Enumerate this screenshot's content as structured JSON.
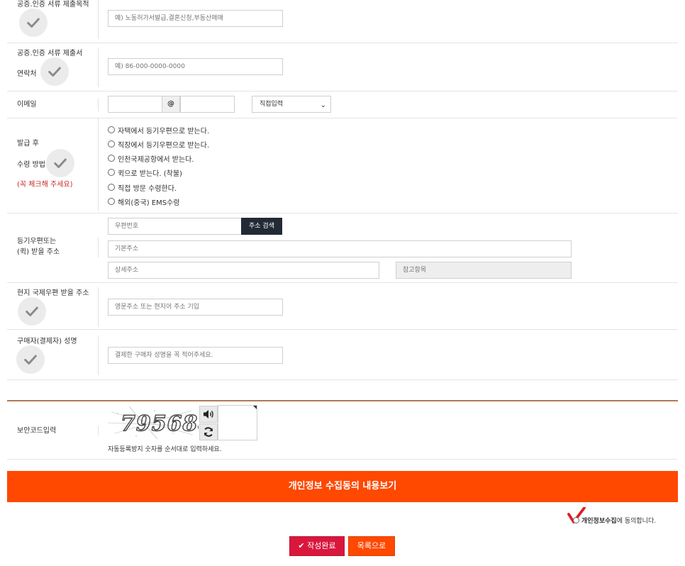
{
  "rows": {
    "purpose": {
      "label": "공증.인증 서류 제출목적",
      "placeholder": "예) 노동허가서발급,결혼신청,부동산매매"
    },
    "contact": {
      "label_line1": "공증.인증 서류 제출서",
      "label_line2": "연락처",
      "placeholder": "예) 86-000-0000-0000"
    },
    "email": {
      "label": "이메일",
      "at": "@",
      "domain_select": "직접입력"
    },
    "receive": {
      "label_line1": "발급 후",
      "label_line2": "수령 방법",
      "note": "(꼭 체크해 주세요)",
      "options": [
        "자택에서 등기우편으로 받는다.",
        "직장에서 등기우편으로 받는다.",
        "인천국제공항에서 받는다.",
        "퀵으로 받는다. (착불)",
        "직접 방문 수령한다.",
        "해외(중국) EMS수령"
      ]
    },
    "address": {
      "label_line1": "등기우편또는",
      "label_line2": "(퀵) 받을 주소",
      "postcode_placeholder": "우편번호",
      "search_button": "주소 검색",
      "basic_placeholder": "기본주소",
      "detail_placeholder": "상세주소",
      "ref_placeholder": "참고항목"
    },
    "local_address": {
      "label": "현지 국제우편 받을 주소",
      "placeholder": "영문주소 또는 현지어 주소 기입"
    },
    "buyer": {
      "label": "구매자(결제자) 성명",
      "placeholder": "결제한 구매자 성명을 꼭 적어주세요."
    },
    "security": {
      "label": "보안코드입력",
      "captcha_text": "795688",
      "hint": "자동등록방지 숫자를 순서대로 입력하세요."
    }
  },
  "privacy_bar": "개인정보 수집동의 내용보기",
  "agree": {
    "strong": "개인정보수집",
    "rest": "에 동의합니다."
  },
  "buttons": {
    "submit": "작성완료",
    "list": "목록으로"
  },
  "icons": {
    "check": "check-icon",
    "speaker": "speaker-icon",
    "refresh": "refresh-icon"
  },
  "colors": {
    "accent_orange": "#ff4800",
    "submit_red": "#d9173d",
    "check_red": "#e31b23"
  }
}
